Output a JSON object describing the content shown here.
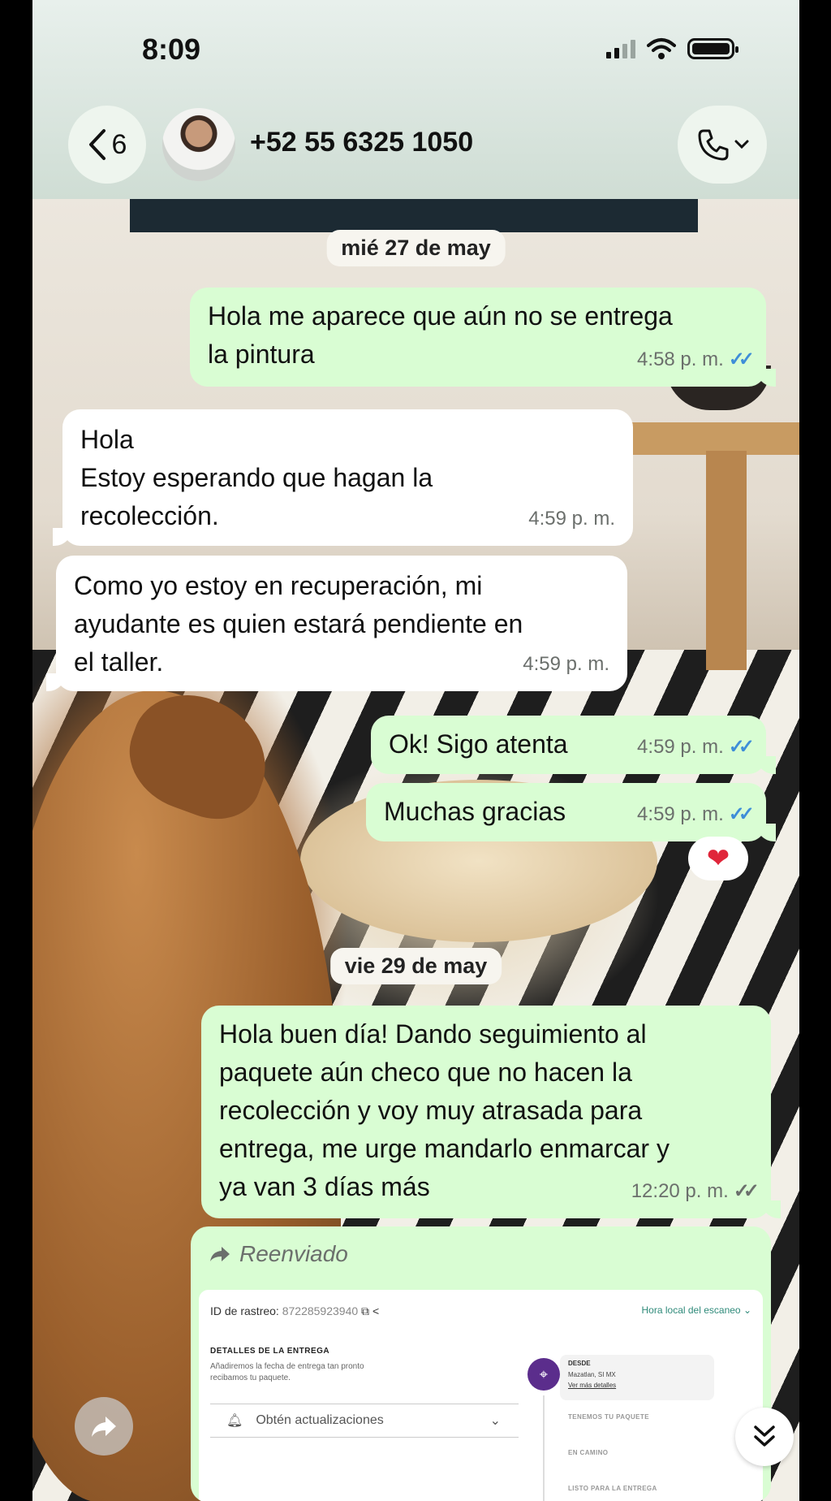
{
  "status_bar": {
    "time": "8:09"
  },
  "header": {
    "back_count": "6",
    "contact": "+52 55 6325 1050"
  },
  "dates": {
    "first": "mié 27 de may",
    "second": "vie 29 de may"
  },
  "messages": [
    {
      "dir": "out",
      "text": "Hola me aparece que aún no se entrega\nla pintura",
      "time": "4:58 p. m.",
      "status": "read"
    },
    {
      "dir": "in",
      "text": "Hola\nEstoy esperando que hagan la\nrecolección.",
      "time": "4:59 p. m."
    },
    {
      "dir": "in",
      "text": "Como yo estoy en recuperación, mi\nayudante es quien estará pendiente en\nel taller.",
      "time": "4:59 p. m."
    },
    {
      "dir": "out",
      "text": "Ok! Sigo atenta",
      "time": "4:59 p. m.",
      "status": "read"
    },
    {
      "dir": "out",
      "text": "Muchas gracias",
      "time": "4:59 p. m.",
      "status": "read",
      "reaction": "❤"
    },
    {
      "dir": "out",
      "text": "Hola buen día! Dando seguimiento al\npaquete aún checo que no hacen la\nrecolección y voy muy atrasada para\nentrega, me urge mandarlo enmarcar y\nya van 3 días más",
      "time": "12:20 p. m.",
      "status": "delivered"
    }
  ],
  "forwarded": {
    "label": "Reenviado",
    "tracking_label": "ID de rastreo:",
    "tracking_id": "872285923940",
    "local_time": "Hora local del escaneo",
    "details_title": "DETALLES DE LA ENTREGA",
    "details_note": "Añadiremos la fecha de entrega tan pronto recibamos tu paquete.",
    "updates": "Obtén actualizaciones",
    "from_title": "DESDE",
    "from_place": "Mazatlan, SI MX",
    "from_link": "Ver más detalles",
    "step1": "TENEMOS TU PAQUETE",
    "step2": "EN CAMINO",
    "step3": "LISTO PARA LA ENTREGA"
  },
  "icons": {
    "back": "chevron-left-icon",
    "call": "phone-icon",
    "reaction": "heart-icon",
    "forward": "forward-arrow-icon",
    "share": "share-icon",
    "scroll": "double-chevron-down-icon"
  },
  "colors": {
    "outgoing": "#d9fdd3",
    "incoming": "#ffffff",
    "read_ticks": "#3f8ed8"
  }
}
